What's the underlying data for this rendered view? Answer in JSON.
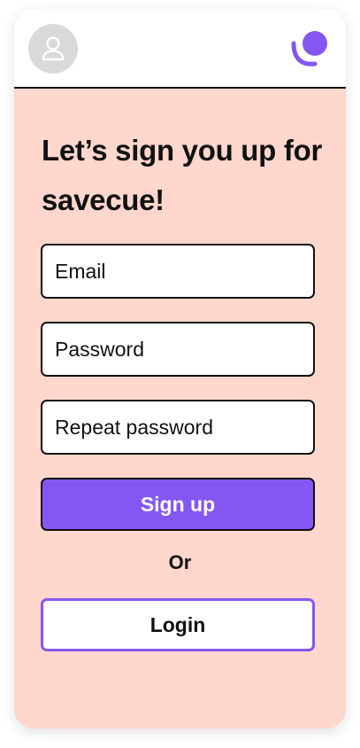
{
  "header": {
    "avatar_icon": "user-icon",
    "logo_icon": "savecue-logo-icon"
  },
  "form": {
    "title": "Let’s sign you up for savecue!",
    "email_placeholder": "Email",
    "password_placeholder": "Password",
    "repeat_password_placeholder": "Repeat password",
    "signup_label": "Sign up",
    "or_label": "Or",
    "login_label": "Login"
  },
  "colors": {
    "background": "#ffd7cc",
    "accent": "#8457f5",
    "border": "#111111",
    "avatar": "#d9d9d9"
  }
}
